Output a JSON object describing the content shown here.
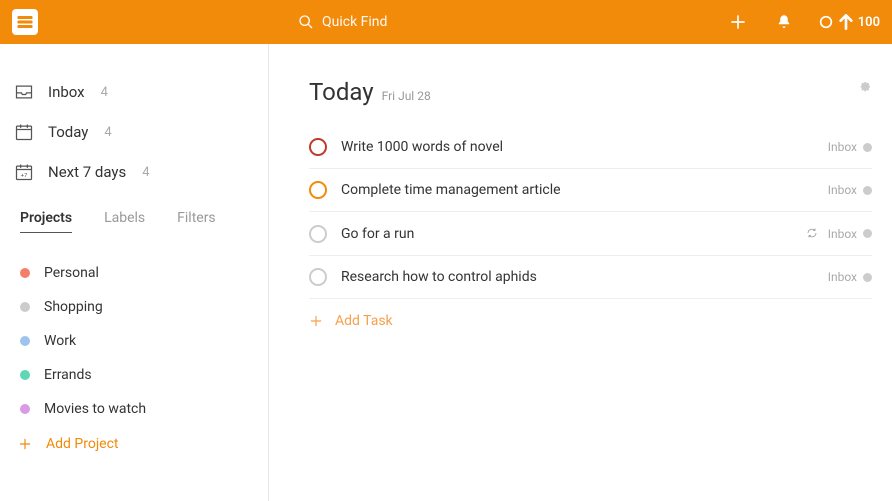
{
  "topbar": {
    "search_placeholder": "Quick Find",
    "karma": "100"
  },
  "sidebar": {
    "nav": [
      {
        "label": "Inbox",
        "count": "4"
      },
      {
        "label": "Today",
        "count": "4"
      },
      {
        "label": "Next 7 days",
        "count": "4"
      }
    ],
    "tabs": {
      "projects": "Projects",
      "labels": "Labels",
      "filters": "Filters"
    },
    "projects": [
      {
        "label": "Personal",
        "color": "#f37f6a"
      },
      {
        "label": "Shopping",
        "color": "#cccccc"
      },
      {
        "label": "Work",
        "color": "#9ec3ef"
      },
      {
        "label": "Errands",
        "color": "#5fd6b6"
      },
      {
        "label": "Movies to watch",
        "color": "#d99be6"
      }
    ],
    "add_project": "Add Project"
  },
  "main": {
    "title": "Today",
    "subtitle": "Fri Jul 28",
    "tasks": [
      {
        "title": "Write 1000 words of novel",
        "project": "Inbox",
        "priority": "p1",
        "recurring": false
      },
      {
        "title": "Complete time management article",
        "project": "Inbox",
        "priority": "p2",
        "recurring": false
      },
      {
        "title": "Go for a run",
        "project": "Inbox",
        "priority": "",
        "recurring": true
      },
      {
        "title": "Research how to control aphids",
        "project": "Inbox",
        "priority": "",
        "recurring": false
      }
    ],
    "add_task": "Add Task"
  }
}
